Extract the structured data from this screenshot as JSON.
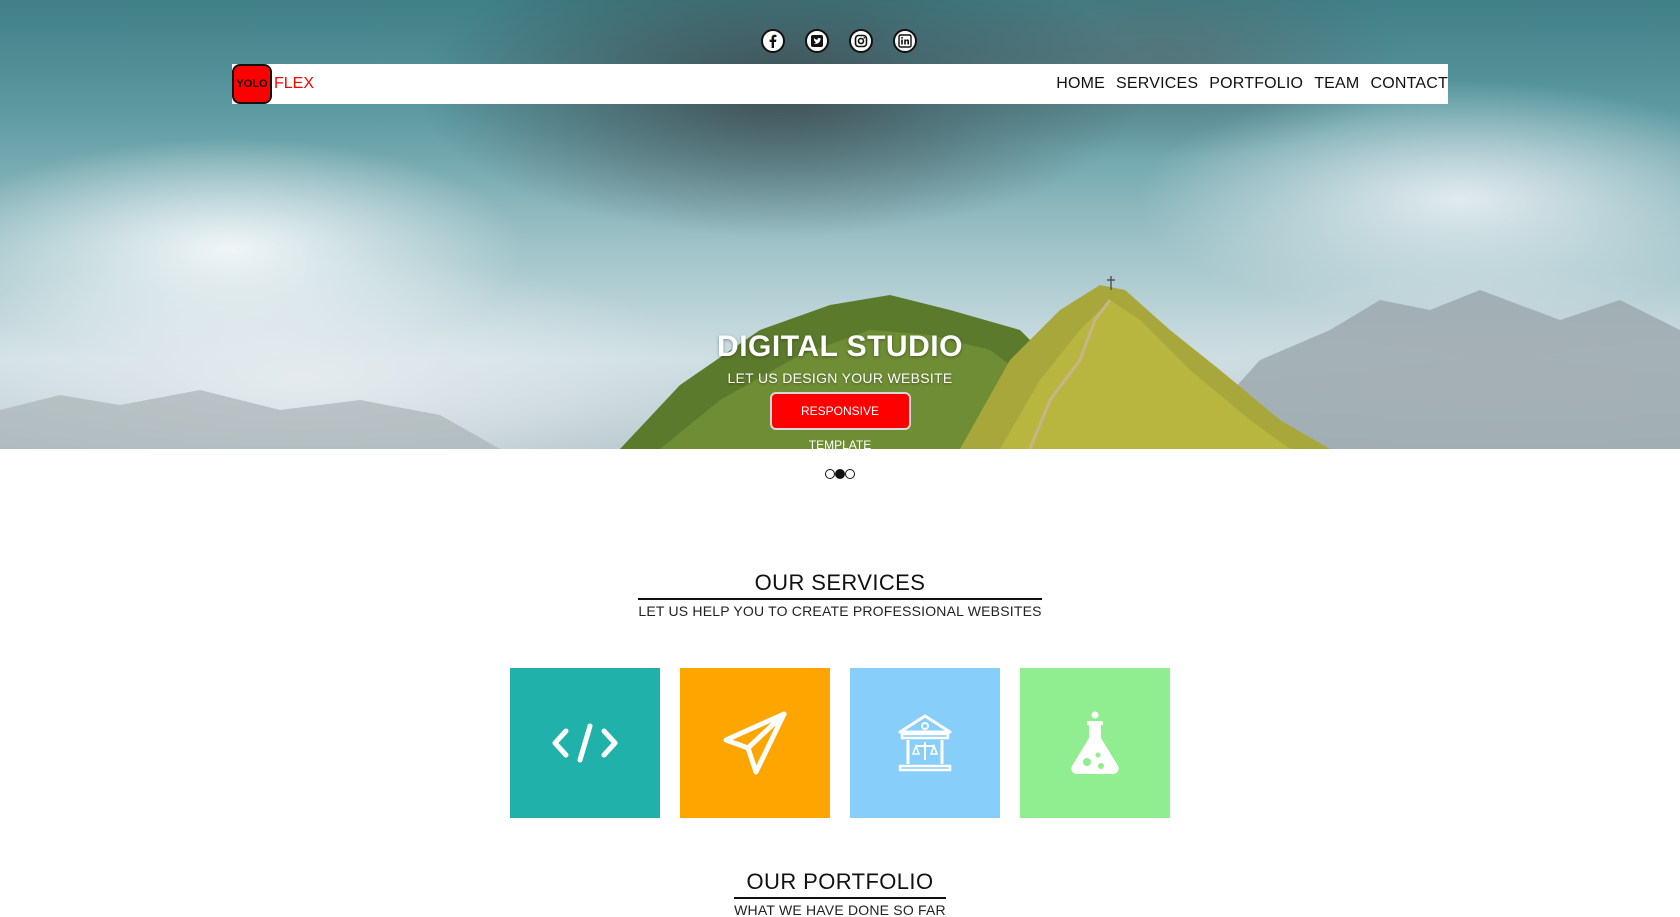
{
  "social": {
    "icons": [
      "facebook-icon",
      "twitter-icon",
      "instagram-icon",
      "linkedin-icon"
    ]
  },
  "brand": {
    "logo_box": "YOLO",
    "logo_text": "FLEX",
    "color": "#ff0000"
  },
  "nav": {
    "items": [
      "HOME",
      "SERVICES",
      "PORTFOLIO",
      "TEAM",
      "CONTACT"
    ]
  },
  "hero": {
    "title": "DIGITAL STUDIO",
    "subtitle": "LET US DESIGN YOUR WEBSITE",
    "button": "RESPONSIVE TEMPLATE"
  },
  "slider": {
    "count": 3,
    "active": 2
  },
  "services": {
    "title": "OUR SERVICES",
    "subtitle": "LET US HELP YOU TO CREATE PROFESSIONAL WEBSITES",
    "tiles": [
      {
        "icon": "code-icon",
        "color": "#20b2aa"
      },
      {
        "icon": "paper-plane-icon",
        "color": "#ffa500"
      },
      {
        "icon": "bank-icon",
        "color": "#87cefa"
      },
      {
        "icon": "flask-icon",
        "color": "#90ee90"
      }
    ]
  },
  "portfolio": {
    "title": "OUR PORTFOLIO",
    "subtitle": "WHAT WE HAVE DONE SO FAR"
  }
}
